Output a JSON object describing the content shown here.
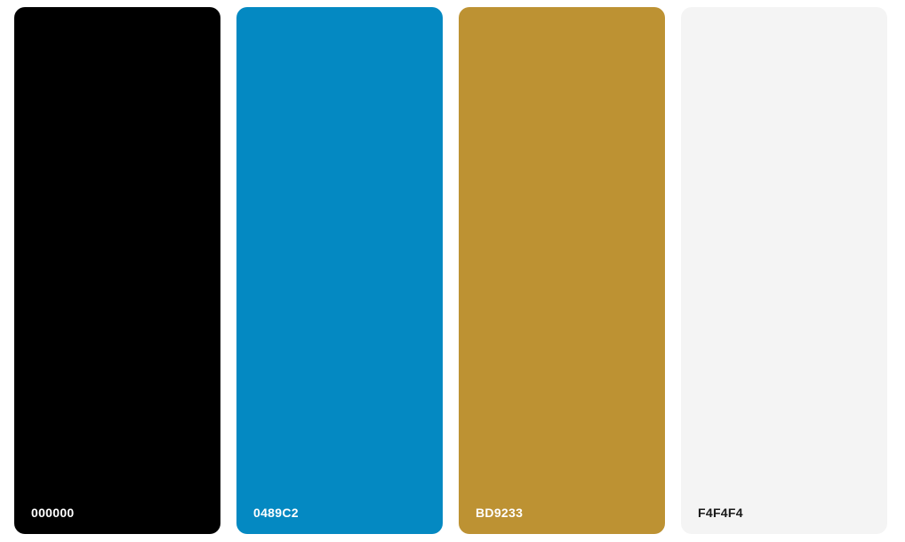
{
  "palette": {
    "swatches": [
      {
        "hex": "000000",
        "color": "#000000",
        "label_color": "#ffffff"
      },
      {
        "hex": "0489C2",
        "color": "#0489C2",
        "label_color": "#ffffff"
      },
      {
        "hex": "BD9233",
        "color": "#BD9233",
        "label_color": "#ffffff"
      },
      {
        "hex": "F4F4F4",
        "color": "#F4F4F4",
        "label_color": "#1a1a1a"
      }
    ]
  }
}
